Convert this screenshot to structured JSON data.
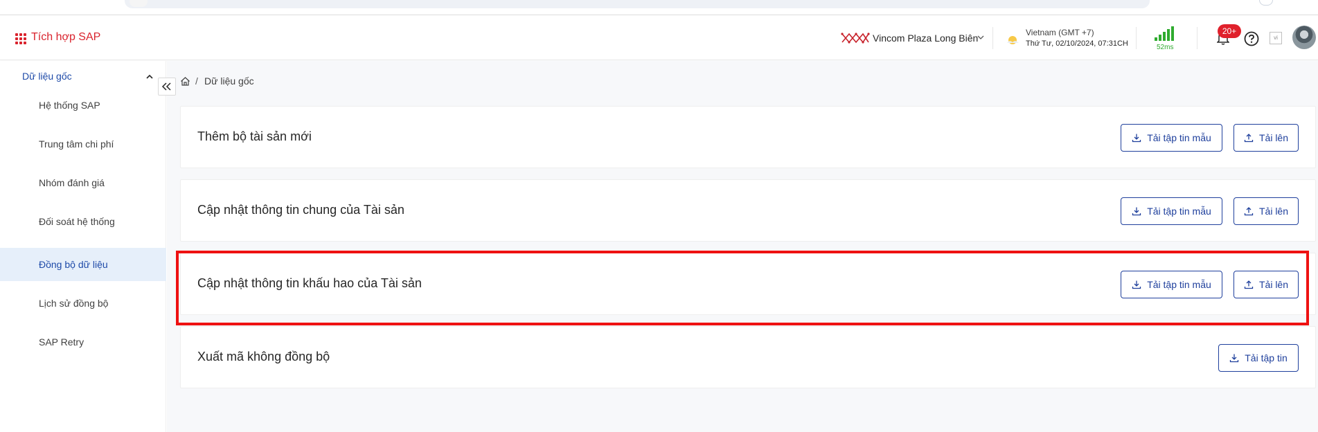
{
  "header": {
    "app_title": "Tích hợp SAP",
    "location": "Vincom Plaza Long Biên",
    "timezone": "Vietnam (GMT +7)",
    "datetime": "Thứ Tư, 02/10/2024, 07:31CH",
    "latency": "52ms",
    "notification_count": "20+",
    "language": "vi",
    "icons": [
      "app-grid-icon",
      "vincom-logo",
      "chevron-down-icon",
      "weather-sun-icon",
      "signal-icon",
      "bell-icon",
      "help-icon",
      "language-icon"
    ]
  },
  "sidebar": {
    "group_label": "Dữ liệu gốc",
    "items": [
      {
        "label": "Hệ thống SAP"
      },
      {
        "label": "Trung tâm chi phí"
      },
      {
        "label": "Nhóm đánh giá"
      },
      {
        "label": "Đối soát hệ thống"
      },
      {
        "label": "Đồng bộ dữ liệu",
        "active": true
      },
      {
        "label": "Lịch sử đồng bộ"
      },
      {
        "label": "SAP Retry"
      }
    ]
  },
  "breadcrumb": {
    "current": "Dữ liệu gốc"
  },
  "cards": [
    {
      "title": "Thêm bộ tài sản mới",
      "template_button": "Tải tập tin mẫu",
      "upload_button": "Tải lên"
    },
    {
      "title": "Cập nhật thông tin chung của Tài sản",
      "template_button": "Tải tập tin mẫu",
      "upload_button": "Tải lên"
    },
    {
      "title": "Cập nhật thông tin khấu hao của Tài sản",
      "template_button": "Tải tập tin mẫu",
      "upload_button": "Tải lên",
      "highlighted": true
    },
    {
      "title": "Xuất mã không đồng bộ",
      "download_button": "Tải tập tin"
    }
  ],
  "colors": {
    "brand_red": "#d9232d",
    "primary_blue": "#1e3f9c",
    "active_bg": "#e6effa",
    "signal_green": "#2fab2f",
    "highlight_red": "#ee1111"
  }
}
